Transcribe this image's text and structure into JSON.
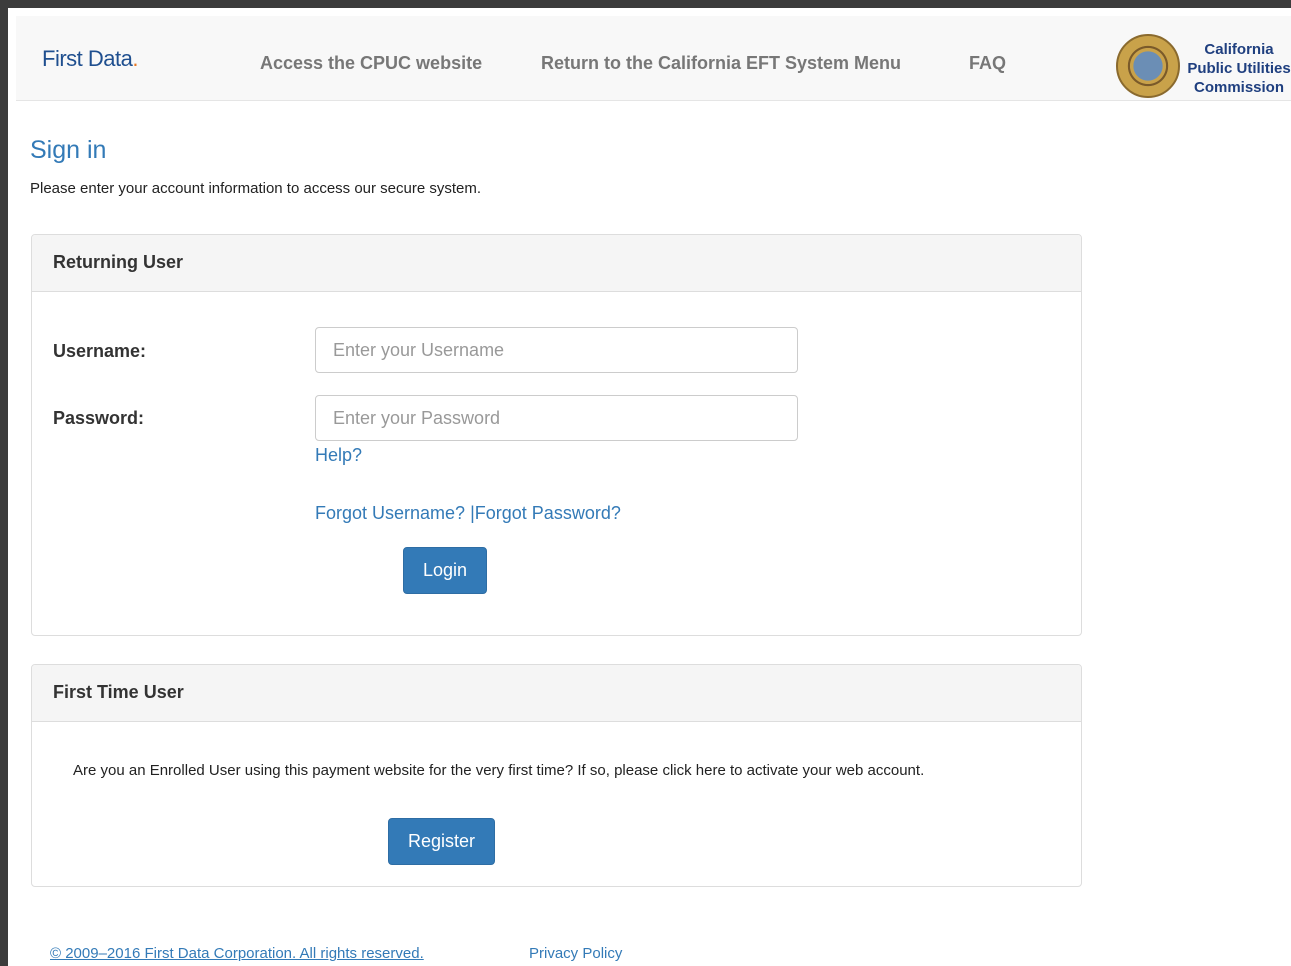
{
  "header": {
    "brand_name": "First Data",
    "brand_dot": ".",
    "nav": {
      "cpuc": "Access the CPUC website",
      "menu": "Return to the California EFT System Menu",
      "faq": "FAQ"
    },
    "commission_line1": "California",
    "commission_line2": "Public Utilities",
    "commission_line3": "Commission"
  },
  "signin": {
    "title": "Sign in",
    "intro": "Please enter your account information to access our secure system."
  },
  "returning": {
    "heading": "Returning User",
    "username_label": "Username:",
    "username_placeholder": "Enter your Username",
    "password_label": "Password:",
    "password_placeholder": "Enter your Password",
    "help": "Help?",
    "forgot_username": "Forgot Username?",
    "separator": "|",
    "forgot_password": "Forgot Password?",
    "login": "Login"
  },
  "first_time": {
    "heading": "First Time User",
    "text": "Are you an Enrolled User using this payment website for the very first time? If so, please click here to activate your web account.",
    "register": "Register"
  },
  "footer": {
    "copyright": "© 2009–2016 First Data Corporation. All rights reserved.",
    "privacy": "Privacy Policy"
  },
  "colors": {
    "link": "#337ab7",
    "button": "#337ab7",
    "brand": "#1f4f8f",
    "brand_dot": "#e87722"
  },
  "icons": {
    "seal": "state-seal-icon"
  }
}
